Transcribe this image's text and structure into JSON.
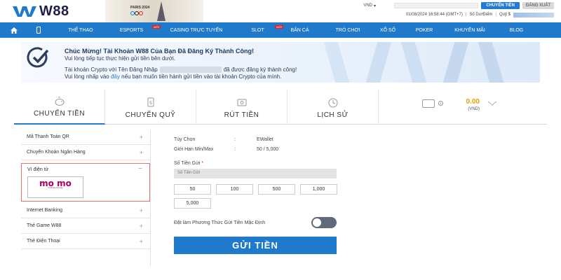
{
  "brand": {
    "name": "W88",
    "event_badge": "PARIS 2024",
    "accent": "#1f7acc"
  },
  "header": {
    "currency": "VND",
    "transfer_button": "CHUYỂN TIỀN",
    "logout_button": "ĐĂNG XUẤT",
    "datetime": "01/08/2024 16:58:44 (GMT+7)",
    "points_label": "Số Dư/Điểm",
    "fund_label": "Quỹ $"
  },
  "nav": {
    "items": [
      {
        "label": "THỂ THAO",
        "new": false
      },
      {
        "label": "ESPORTS",
        "new": true
      },
      {
        "label": "CASINO TRỰC TUYẾN",
        "new": false
      },
      {
        "label": "SLOT",
        "new": true
      },
      {
        "label": "BẮN CÁ",
        "new": false
      },
      {
        "label": "TRÒ CHƠI",
        "new": false
      },
      {
        "label": "XỔ SỐ",
        "new": false
      },
      {
        "label": "POKER",
        "new": false
      },
      {
        "label": "KHUYẾN MÃI",
        "new": false
      },
      {
        "label": "BLOG",
        "new": false
      }
    ],
    "new_tag": "MỚI"
  },
  "banner": {
    "title": "Chúc Mừng! Tài Khoản W88 Của Bạn Đã Đăng Ký Thành Công!",
    "subtitle": "Vui lòng tiếp tục thực hiện gửi tiền bên dưới.",
    "line3_prefix": "Tài khoản Crypto với Tên Đăng Nhập",
    "line3_suffix": "đã được đăng ký thành công!",
    "line4_prefix": "Vui lòng nhấp vào",
    "line4_link": "đây",
    "line4_suffix": "nếu bạn muốn tiền hành gửi tiền vào tài khoản Crypto của mình."
  },
  "tabs": [
    {
      "label": "CHUYỂN TIỀN",
      "icon": "piggy-bank-icon",
      "active": true
    },
    {
      "label": "CHUYỂN QUỸ",
      "icon": "transfer-funds-icon",
      "active": false
    },
    {
      "label": "RÚT TIỀN",
      "icon": "withdraw-icon",
      "active": false
    },
    {
      "label": "LỊCH SỬ",
      "icon": "history-icon",
      "active": false
    }
  ],
  "balance": {
    "value": "0.00",
    "unit": "(VND)",
    "color": "#e8a200"
  },
  "sidebar": {
    "items_before": [
      {
        "label": "Mã Thanh Toán QR"
      },
      {
        "label": "Chuyển Khoản Ngân Hàng"
      }
    ],
    "expanded": {
      "label": "Ví điện tử",
      "logo_text": "mo mo",
      "logo_tag": "mobile money"
    },
    "items_after": [
      {
        "label": "Internet Banking"
      },
      {
        "label": "Thẻ Game W88"
      },
      {
        "label": "Thẻ Điện Thoại"
      }
    ]
  },
  "form": {
    "option_label": "Tùy Chọn",
    "option_value": "EWallet",
    "limit_label": "Giới Hạn Min/Max",
    "limit_value": "50 / 5,000",
    "amount_label": "Số Tiền Gửi",
    "amount_required": "*",
    "amount_placeholder": "Số Tiền Gửi",
    "quick_amounts": [
      "50",
      "100",
      "500",
      "1,000",
      "5,000"
    ],
    "default_label": "Đặt làm Phương Thức Gửi Tiền Mặc Định",
    "default_on": false,
    "submit": "GỬI TIỀN"
  }
}
